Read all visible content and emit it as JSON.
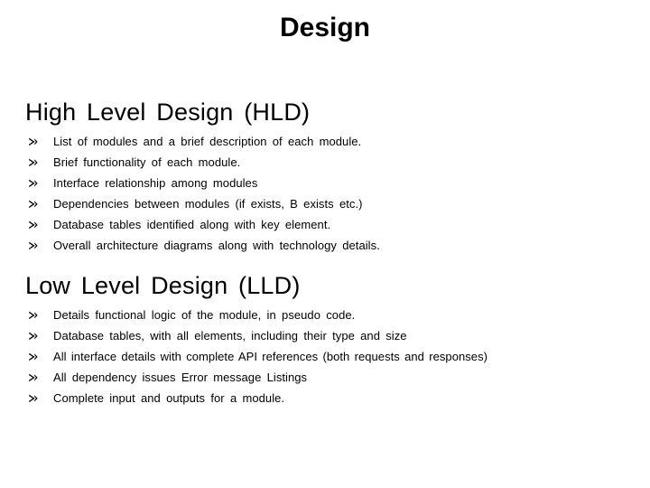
{
  "slide": {
    "title": "Design",
    "background_color": "#ffffff",
    "text_color": "#000000",
    "bullet_glyph": "arrowhead-bullet-icon",
    "sections": [
      {
        "heading": "High  Level  Design  (HLD)",
        "items": [
          "List of modules and a brief description of each module.",
          "Brief functionality of each module.",
          "Interface relationship among modules",
          "Dependencies between modules (if exists, B exists etc.)",
          "Database tables identified along with key element.",
          "Overall architecture diagrams along with technology details."
        ]
      },
      {
        "heading": "Low  Level  Design  (LLD)",
        "items": [
          "Details functional logic of the module, in pseudo code.",
          "Database tables, with all elements, including their type and size",
          "All interface details with complete API references (both requests and responses)",
          "All dependency issues Error message Listings",
          "Complete input and outputs for a module."
        ]
      }
    ]
  }
}
